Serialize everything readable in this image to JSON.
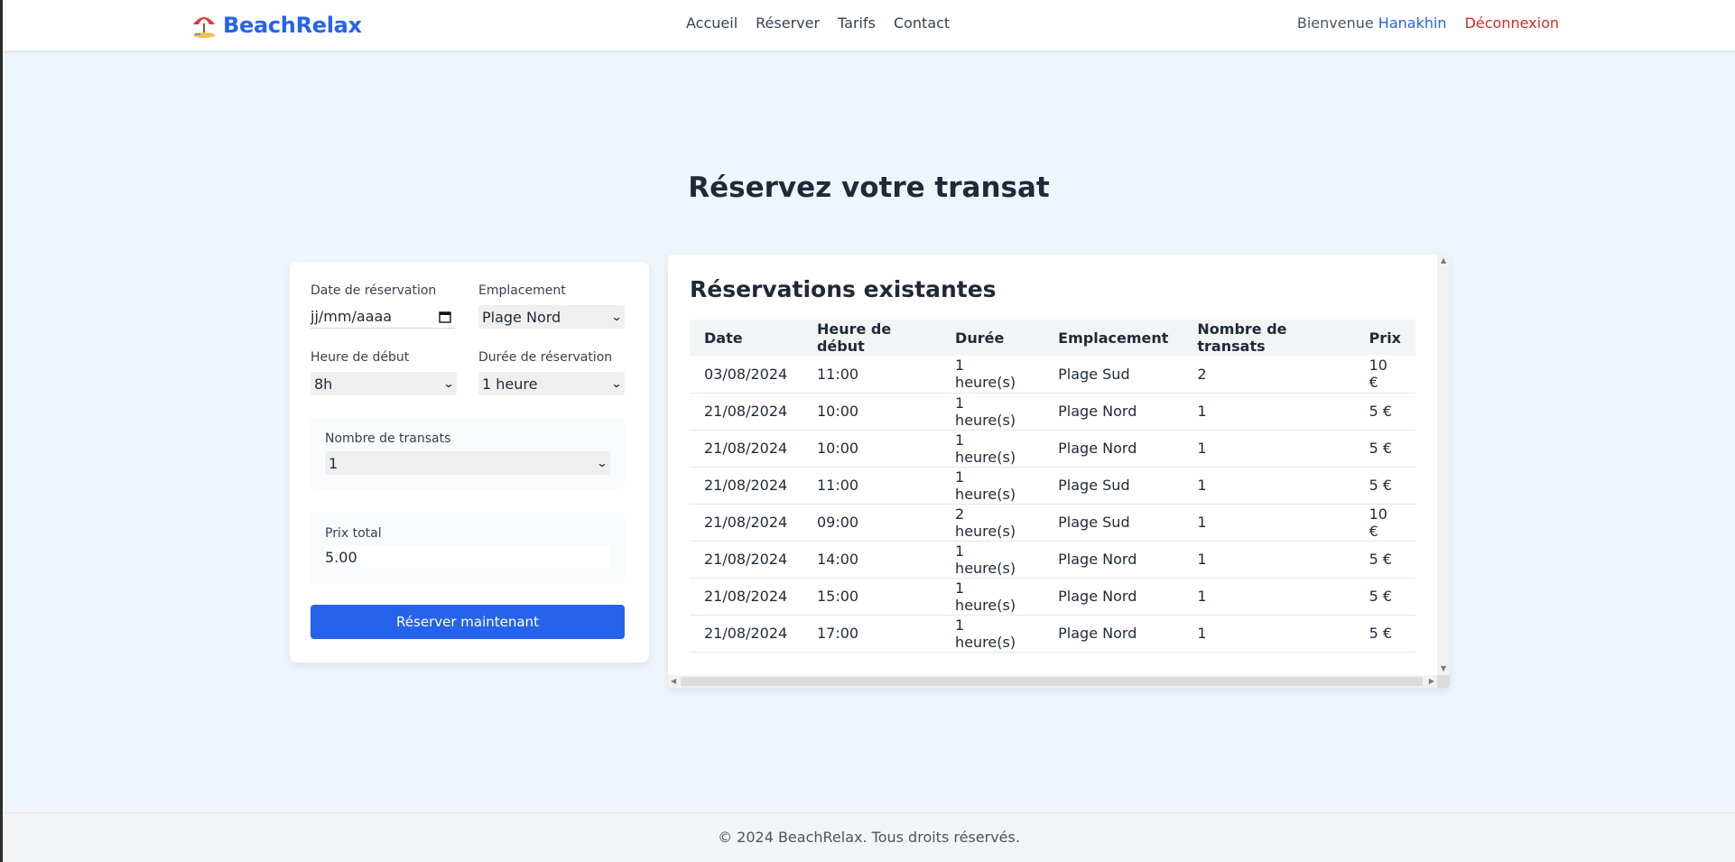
{
  "header": {
    "brand": "BeachRelax",
    "nav": [
      "Accueil",
      "Réserver",
      "Tarifs",
      "Contact"
    ],
    "welcome_prefix": "Bienvenue",
    "username": "Hanakhin",
    "logout": "Déconnexion"
  },
  "page_title": "Réservez votre transat",
  "form": {
    "date_label": "Date de réservation",
    "date_value": "jj/mm/aaaa",
    "location_label": "Emplacement",
    "location_value": "Plage Nord",
    "start_label": "Heure de début",
    "start_value": "8h",
    "duration_label": "Durée de réservation",
    "duration_value": "1 heure",
    "count_label": "Nombre de transats",
    "count_value": "1",
    "price_label": "Prix total",
    "price_value": "5.00",
    "submit": "Réserver maintenant"
  },
  "reservations": {
    "title": "Réservations existantes",
    "columns": [
      "Date",
      "Heure de début",
      "Durée",
      "Emplacement",
      "Nombre de transats",
      "Prix"
    ],
    "rows": [
      [
        "03/08/2024",
        "11:00",
        "1 heure(s)",
        "Plage Sud",
        "2",
        "10 €"
      ],
      [
        "21/08/2024",
        "10:00",
        "1 heure(s)",
        "Plage Nord",
        "1",
        "5 €"
      ],
      [
        "21/08/2024",
        "10:00",
        "1 heure(s)",
        "Plage Nord",
        "1",
        "5 €"
      ],
      [
        "21/08/2024",
        "11:00",
        "1 heure(s)",
        "Plage Sud",
        "1",
        "5 €"
      ],
      [
        "21/08/2024",
        "09:00",
        "2 heure(s)",
        "Plage Sud",
        "1",
        "10 €"
      ],
      [
        "21/08/2024",
        "14:00",
        "1 heure(s)",
        "Plage Nord",
        "1",
        "5 €"
      ],
      [
        "21/08/2024",
        "15:00",
        "1 heure(s)",
        "Plage Nord",
        "1",
        "5 €"
      ],
      [
        "21/08/2024",
        "17:00",
        "1 heure(s)",
        "Plage Nord",
        "1",
        "5 €"
      ]
    ]
  },
  "footer": "© 2024 BeachRelax. Tous droits réservés.",
  "icons": {
    "logo": "beach-umbrella-icon",
    "date": "calendar-icon",
    "select": "chevron-down-icon"
  },
  "colors": {
    "accent": "#2563eb",
    "logout": "#dc2626",
    "background": "#eef5fd"
  }
}
